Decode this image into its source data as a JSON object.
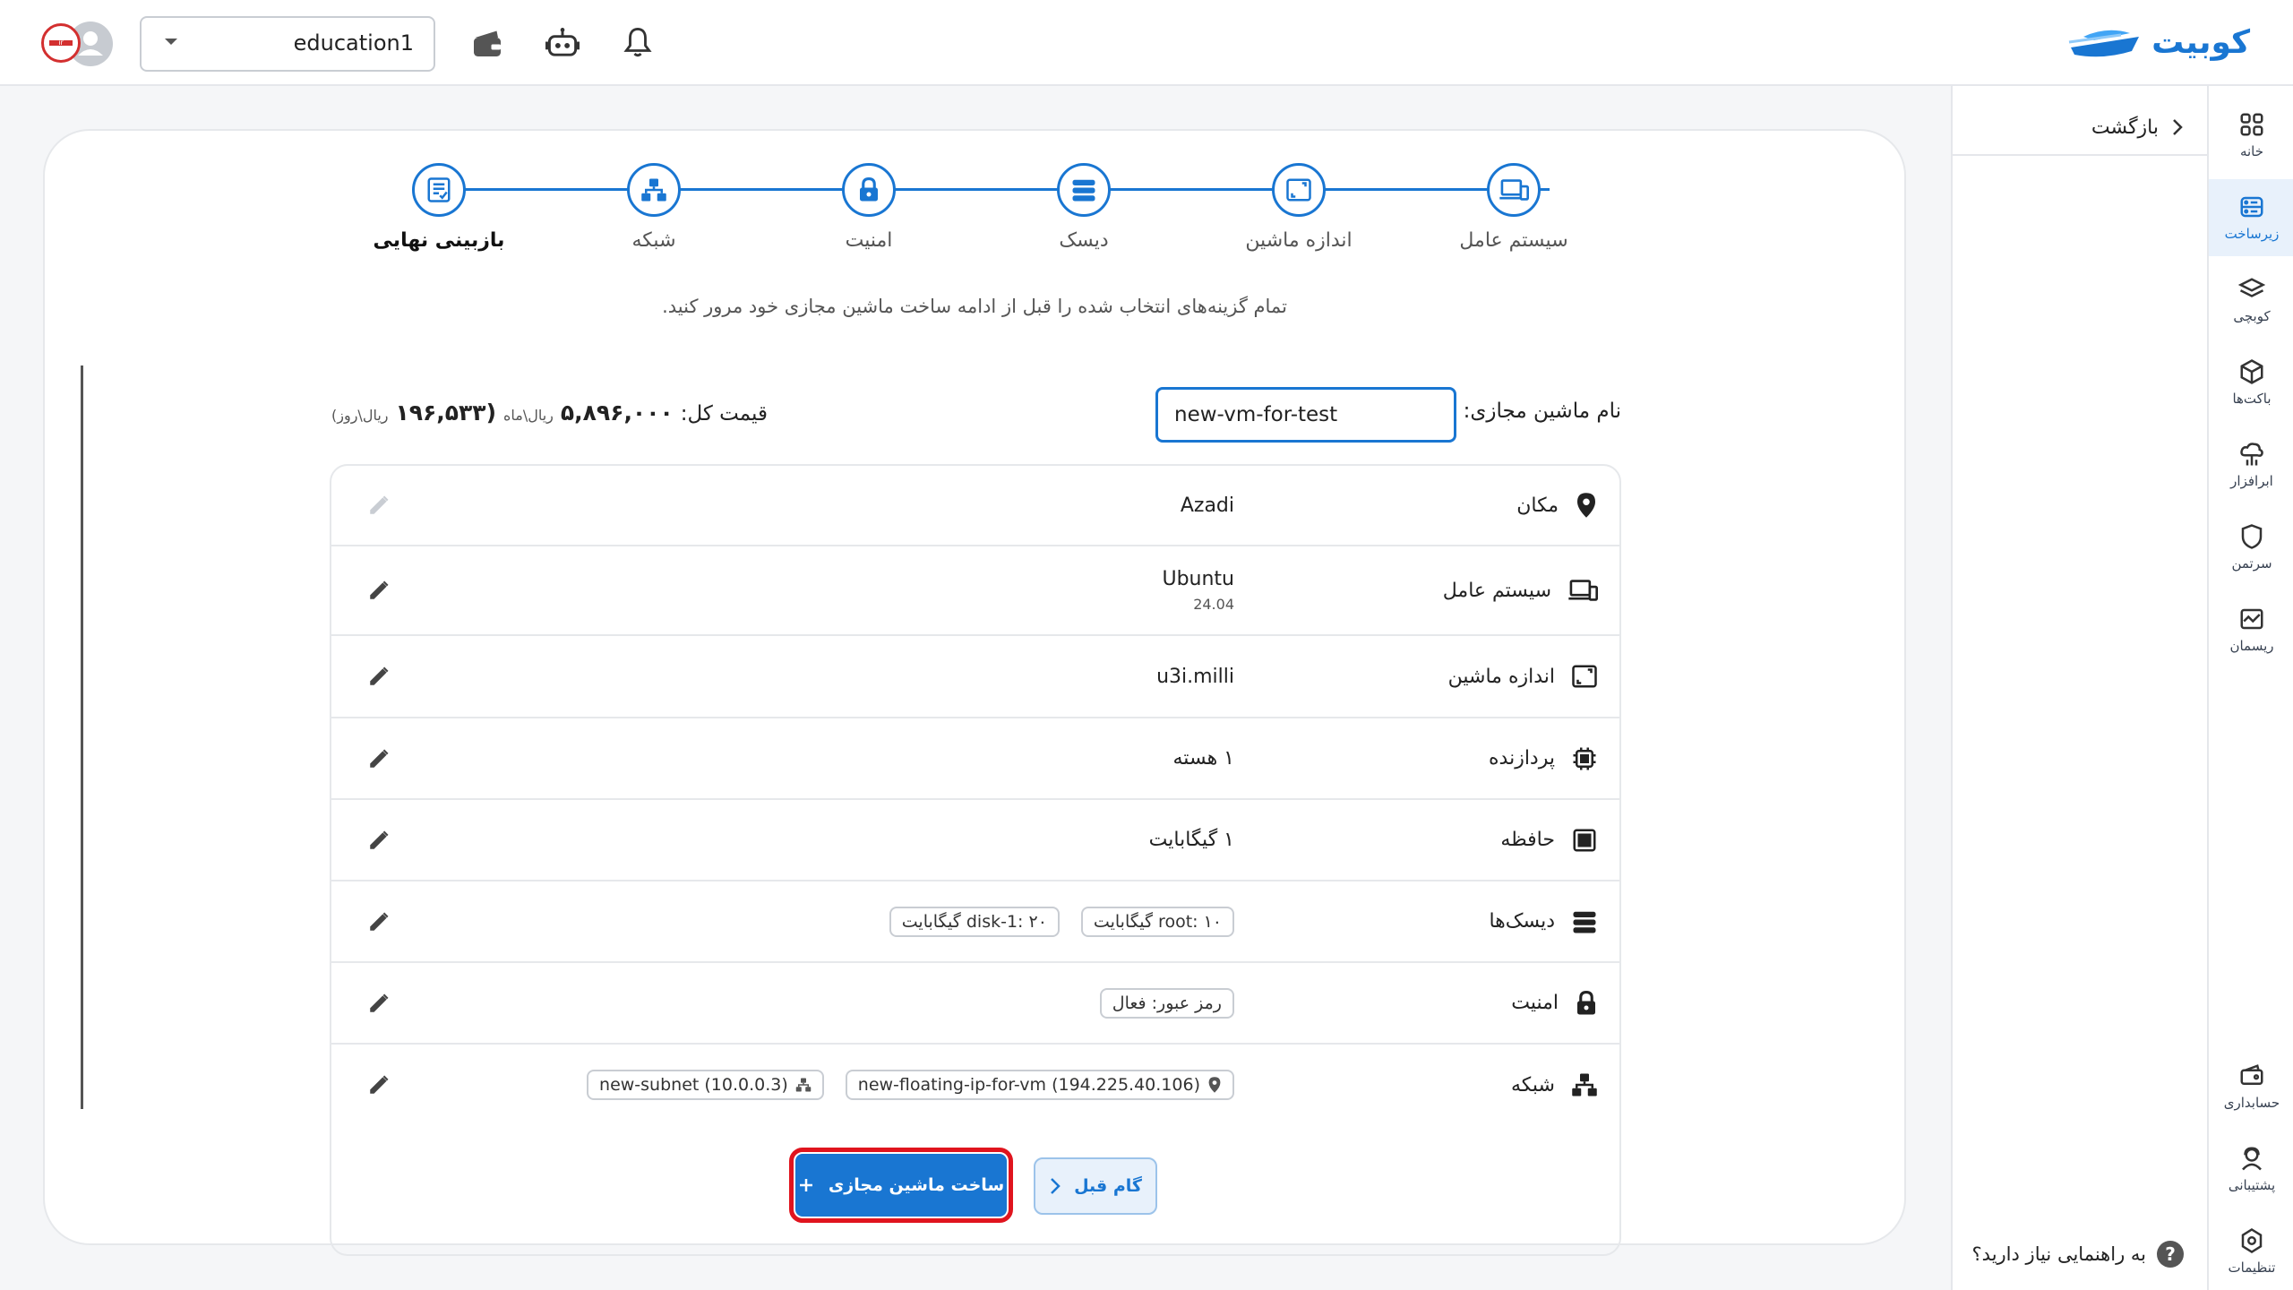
{
  "app": {
    "logo_text": "کوبیت",
    "brand_color": "#1976d2"
  },
  "topbar": {
    "project": "education1"
  },
  "rail": [
    {
      "label": "خانه",
      "icon": "grid-icon"
    },
    {
      "label": "زیرساخت",
      "icon": "server-icon",
      "active": true
    },
    {
      "label": "کوبچی",
      "icon": "layers-icon"
    },
    {
      "label": "باکت‌ها",
      "icon": "cube-icon"
    },
    {
      "label": "ابرافزار",
      "icon": "cloud-tree-icon"
    },
    {
      "label": "سرتمن",
      "icon": "shield-icon"
    },
    {
      "label": "ریسمان",
      "icon": "chart-icon"
    },
    {
      "label": "حسابداری",
      "icon": "wallet-icon"
    },
    {
      "label": "پشتیبانی",
      "icon": "support-icon"
    },
    {
      "label": "تنظیمات",
      "icon": "settings-icon"
    }
  ],
  "subpanel": {
    "back": "بازگشت",
    "help": "به راهنمایی نیاز دارید؟"
  },
  "stepper": {
    "steps": [
      "سیستم عامل",
      "اندازه ماشین",
      "دیسک",
      "امنیت",
      "شبکه",
      "بازبینی نهایی"
    ],
    "current": 5,
    "hint": "تمام گزینه‌های انتخاب شده را قبل از ادامه ساخت ماشین مجازی خود مرور کنید."
  },
  "summary": {
    "name_label": "نام ماشین مجازی:",
    "name_value": "new-vm-for-test",
    "price_label": "قیمت کل:",
    "price_month": "۵,۸۹۶,۰۰۰",
    "price_month_unit": "ریال\\ماه",
    "price_day": "(۱۹۶,۵۳۳",
    "price_day_unit": "ریال\\روز)",
    "rows": [
      {
        "label": "مکان",
        "icon": "location-icon",
        "value": "Azadi",
        "editable": false
      },
      {
        "label": "سیستم عامل",
        "icon": "devices-icon",
        "value": "Ubuntu",
        "sub": "24.04",
        "editable": true
      },
      {
        "label": "اندازه ماشین",
        "icon": "resize-icon",
        "value": "u3i.milli",
        "editable": true
      },
      {
        "label": "پردازنده",
        "icon": "cpu-icon",
        "value": "۱ هسته",
        "editable": true
      },
      {
        "label": "حافظه",
        "icon": "memory-icon",
        "value": "۱ گیگابایت",
        "editable": true
      },
      {
        "label": "دیسک‌ها",
        "icon": "disk-icon",
        "chips": [
          "root: ۱۰ گیگابایت",
          "disk-1: ۲۰ گیگابایت"
        ],
        "editable": true
      },
      {
        "label": "امنیت",
        "icon": "lock-icon",
        "chips": [
          "رمز عبور: فعال"
        ],
        "editable": true
      },
      {
        "label": "شبکه",
        "icon": "network-icon",
        "chips": [
          "new-floating-ip-for-vm (194.225.40.106)",
          "new-subnet (10.0.0.3)"
        ],
        "editable": true
      }
    ]
  },
  "actions": {
    "create": "ساخت ماشین مجازی",
    "prev": "گام قبل"
  }
}
